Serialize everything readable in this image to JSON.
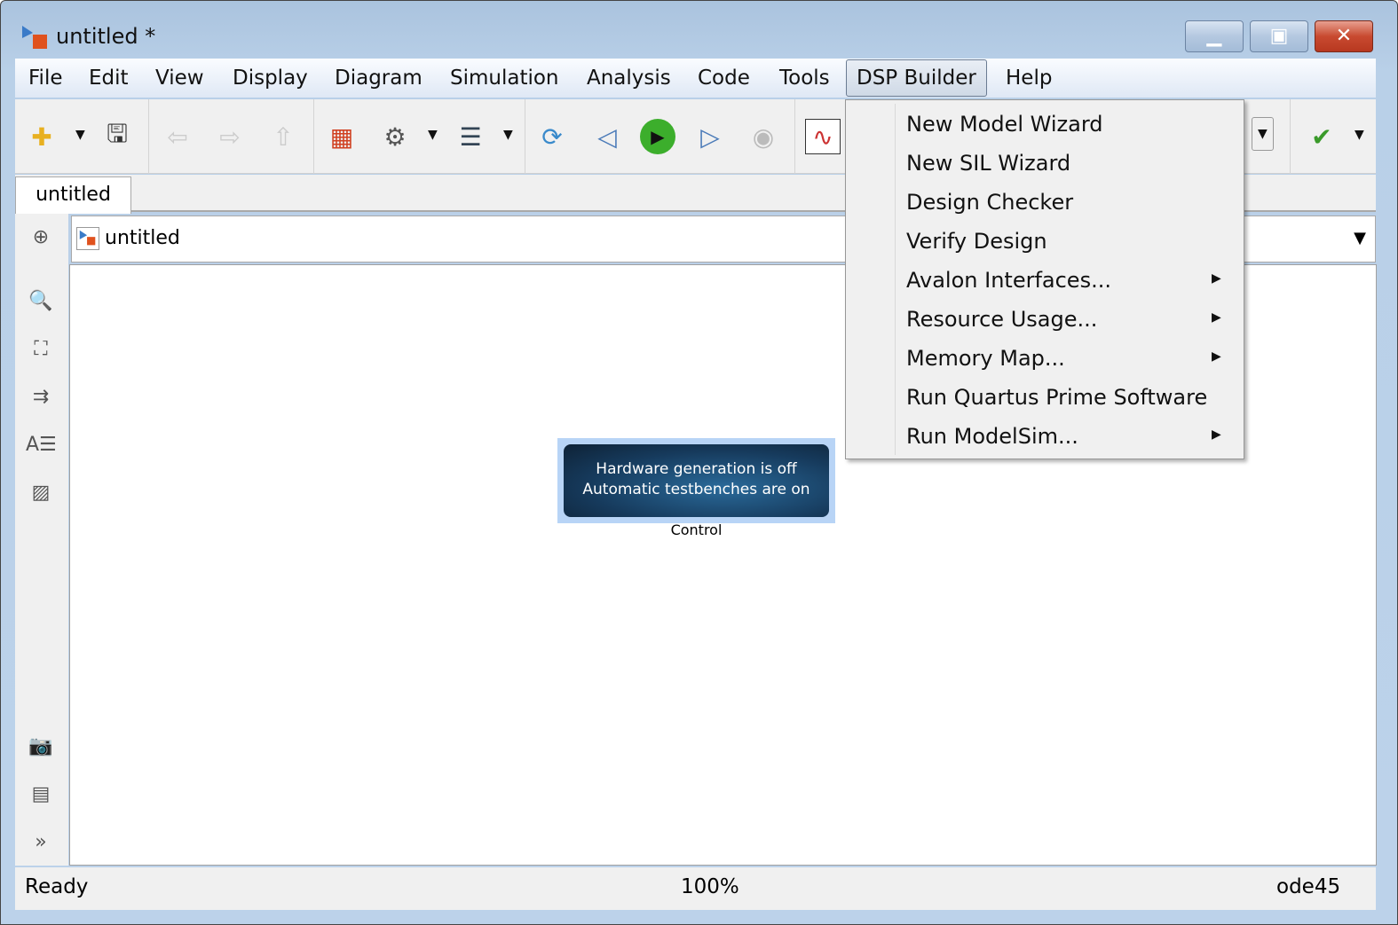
{
  "window": {
    "title": "untitled *"
  },
  "menubar": [
    "File",
    "Edit",
    "View",
    "Display",
    "Diagram",
    "Simulation",
    "Analysis",
    "Code",
    "Tools",
    "DSP Builder",
    "Help"
  ],
  "tab": "untitled",
  "address": "untitled",
  "block": {
    "line1": "Hardware generation is off",
    "line2": "Automatic testbenches are on",
    "label": "Control"
  },
  "status": {
    "left": "Ready",
    "zoom": "100%",
    "solver": "ode45"
  },
  "dsp_menu": [
    {
      "label": "New Model Wizard",
      "submenu": false
    },
    {
      "label": "New SIL Wizard",
      "submenu": false
    },
    {
      "label": "Design Checker",
      "submenu": false
    },
    {
      "label": "Verify Design",
      "submenu": false
    },
    {
      "label": "Avalon Interfaces...",
      "submenu": true
    },
    {
      "label": "Resource Usage...",
      "submenu": true
    },
    {
      "label": "Memory Map...",
      "submenu": true
    },
    {
      "label": "Run Quartus Prime Software",
      "submenu": false
    },
    {
      "label": "Run ModelSim...",
      "submenu": true
    }
  ]
}
